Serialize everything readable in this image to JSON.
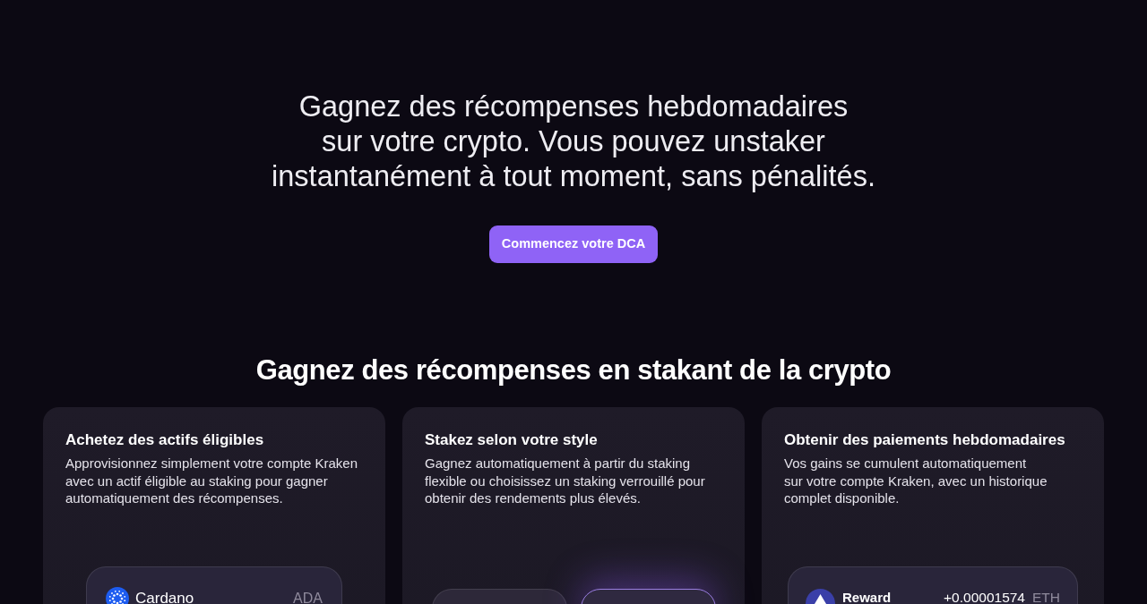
{
  "hero": {
    "text": "Gagnez des récompenses hebdomadaires\nsur votre crypto. Vous pouvez unstaker\ninstantanément à tout moment, sans pénalités.",
    "button": "Commencez votre DCA"
  },
  "section": {
    "title": "Gagnez des récompenses en stakant de la crypto",
    "cards": [
      {
        "kind": "asset",
        "title": "Achetez des actifs éligibles",
        "description": "Approvisionnez simplement votre compte Kraken\navec un actif éligible au staking pour gagner\nautomatiquement des récompenses.",
        "widget": {
          "name": "Cardano",
          "ticker": "ADA"
        }
      },
      {
        "kind": "options",
        "title": "Stakez selon votre style",
        "description": "Gagnez automatiquement à partir du staking\nflexible ou choisissez un staking verrouillé pour\nobtenir des rendements plus élevés.",
        "widget": {
          "options": [
            {
              "selected": false
            },
            {
              "selected": true
            }
          ]
        }
      },
      {
        "kind": "reward",
        "title": "Obtenir des paiements hebdomadaires",
        "description": "Vos gains se cumulent automatiquement\nsur votre compte Kraken, avec un historique\ncomplet disponible.",
        "widget": {
          "label": "Reward",
          "amount": "+0.00001574",
          "unit": "ETH"
        }
      }
    ]
  }
}
